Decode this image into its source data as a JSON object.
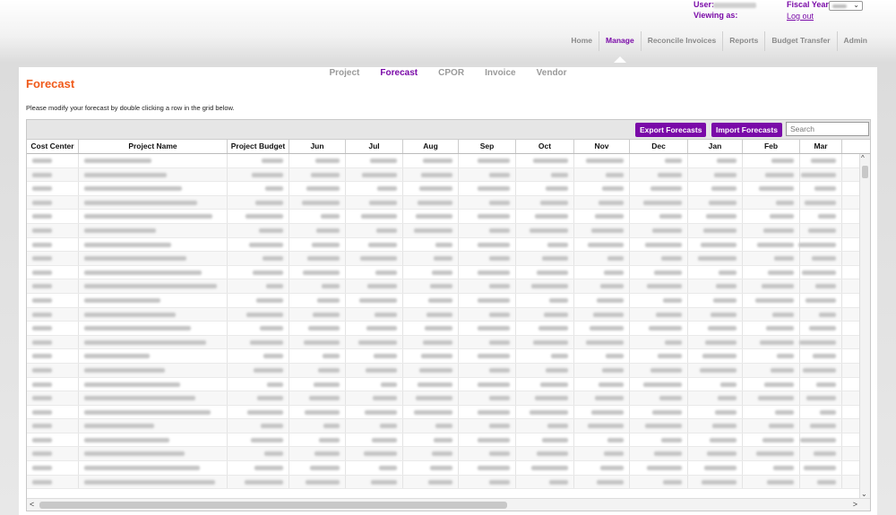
{
  "header": {
    "user_label": "User:",
    "viewing_as_label": "Viewing as:",
    "fiscal_year_label": "Fiscal Year:",
    "logout_label": "Log out"
  },
  "nav": {
    "items": [
      {
        "label": "Home"
      },
      {
        "label": "Manage"
      },
      {
        "label": "Reconcile Invoices"
      },
      {
        "label": "Reports"
      },
      {
        "label": "Budget Transfer"
      },
      {
        "label": "Admin"
      }
    ],
    "active": "Manage"
  },
  "subnav": {
    "items": [
      {
        "label": "Project"
      },
      {
        "label": "Forecast"
      },
      {
        "label": "CPOR"
      },
      {
        "label": "Invoice"
      },
      {
        "label": "Vendor"
      }
    ],
    "active": "Forecast"
  },
  "page": {
    "title": "Forecast",
    "instructions": "Please modify your forecast by double clicking a row in the grid below."
  },
  "toolbar": {
    "export_label": "Export Forecasts",
    "import_label": "Import Forecasts",
    "search_placeholder": "Search"
  },
  "grid": {
    "columns": [
      "Cost Center",
      "Project Name",
      "Project Budget",
      "Jun",
      "Jul",
      "Aug",
      "Sep",
      "Oct",
      "Nov",
      "Dec",
      "Jan",
      "Feb",
      "Mar"
    ]
  },
  "colors": {
    "accent": "#7a0aa8",
    "title": "#f05a1a"
  }
}
